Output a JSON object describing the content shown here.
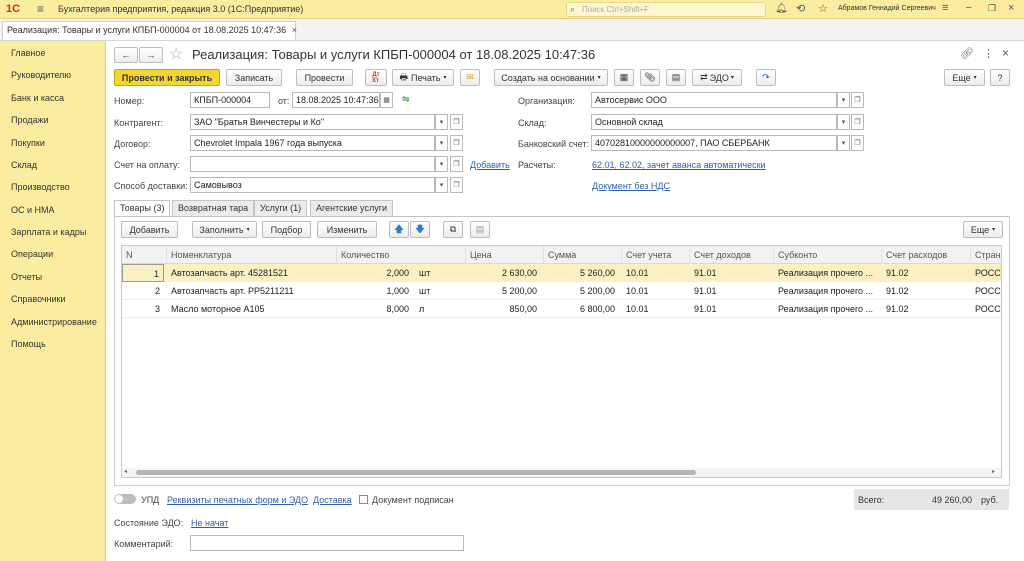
{
  "app": {
    "title": "Бухгалтерия предприятия, редакция 3.0  (1С:Предприятие)",
    "search_placeholder": "Поиск Ctrl+Shift+F",
    "user": "Абрамов Геннадий Сергеевич"
  },
  "tab": {
    "label": "Реализация: Товары и услуги КПБП-000004 от 18.08.2025 10:47:36"
  },
  "sidebar": {
    "items": [
      "Главное",
      "Руководителю",
      "Банк и касса",
      "Продажи",
      "Покупки",
      "Склад",
      "Производство",
      "ОС и НМА",
      "Зарплата и кадры",
      "Операции",
      "Отчеты",
      "Справочники",
      "Администрирование",
      "Помощь"
    ]
  },
  "doc": {
    "title": "Реализация: Товары и услуги КПБП-000004 от 18.08.2025 10:47:36"
  },
  "toolbar": {
    "post_close": "Провести и закрыть",
    "save": "Записать",
    "post": "Провести",
    "print": "Печать",
    "create_based": "Создать на основании",
    "edo": "ЭДО",
    "more": "Еще",
    "help": "?"
  },
  "form": {
    "number_label": "Номер:",
    "number": "КПБП-000004",
    "date_label": "от:",
    "date": "18.08.2025 10:47:36",
    "org_label": "Организация:",
    "org": "Автосервис ООО",
    "counterparty_label": "Контрагент:",
    "counterparty": "ЗАО \"Братья Винчестеры и Ко\"",
    "warehouse_label": "Склад:",
    "warehouse": "Основной склад",
    "contract_label": "Договор:",
    "contract": "Chevrolet Impala 1967 года выпуска",
    "bank_label": "Банковский счет:",
    "bank": "40702810000000000007, ПАО СБЕРБАНК",
    "invoice_label": "Счет на оплату:",
    "invoice": "",
    "invoice_link": "Добавить",
    "settlements_label": "Расчеты:",
    "settlements_link": "62.01, 62.02, зачет аванса автоматически",
    "delivery_label": "Способ доставки:",
    "delivery": "Самовывоз",
    "vat_link": "Документ без НДС"
  },
  "tabs": [
    "Товары (3)",
    "Возвратная тара",
    "Услуги (1)",
    "Агентские услуги"
  ],
  "table_toolbar": {
    "add": "Добавить",
    "fill": "Заполнить",
    "pick": "Подбор",
    "change": "Изменить",
    "more": "Еще"
  },
  "table": {
    "headers": [
      "N",
      "Номенклатура",
      "Количество",
      "Цена",
      "Сумма",
      "Счет учета",
      "Счет доходов",
      "Субконто",
      "Счет расходов",
      "Страна"
    ],
    "rows": [
      [
        "1",
        "Автозапчасть арт. 45281521",
        "2,000",
        "шт",
        "2 630,00",
        "5 260,00",
        "10.01",
        "91.01",
        "Реализация прочего ...",
        "91.02",
        "РОССИ"
      ],
      [
        "2",
        "Автозапчасть арт. PP5211211",
        "1,000",
        "шт",
        "5 200,00",
        "5 200,00",
        "10.01",
        "91.01",
        "Реализация прочего ...",
        "91.02",
        "РОССИ"
      ],
      [
        "3",
        "Масло моторное А105",
        "8,000",
        "л",
        "850,00",
        "6 800,00",
        "10.01",
        "91.01",
        "Реализация прочего ...",
        "91.02",
        "РОССИ"
      ]
    ]
  },
  "footer": {
    "upd": "УПД",
    "print_forms_link": "Реквизиты печатных форм и ЭДО",
    "delivery_link": "Доставка",
    "signed": "Документ подписан",
    "total_label": "Всего:",
    "total": "49 260,00",
    "currency": "руб.",
    "edo_state_label": "Состояние ЭДО:",
    "edo_state": "Не начат",
    "comment_label": "Комментарий:",
    "comment": ""
  }
}
